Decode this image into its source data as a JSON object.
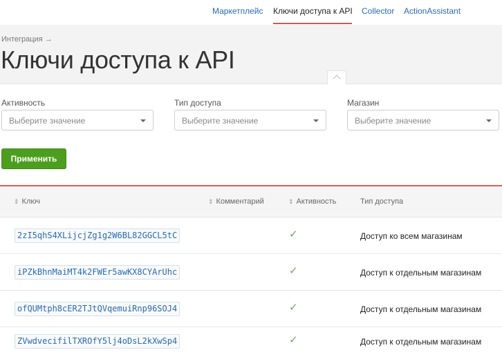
{
  "nav": {
    "tabs": [
      {
        "label": "Маркетплейс"
      },
      {
        "label": "Ключи доступа к API"
      },
      {
        "label": "Collector"
      },
      {
        "label": "ActionAssistant"
      }
    ]
  },
  "header": {
    "breadcrumb": "Интеграция →",
    "title": "Ключи доступа к API"
  },
  "filters": {
    "activity": {
      "label": "Активность",
      "placeholder": "Выберите значение"
    },
    "access_type": {
      "label": "Тип доступа",
      "placeholder": "Выберите значение"
    },
    "shop": {
      "label": "Магазин",
      "placeholder": "Выберите значение"
    },
    "apply_label": "Применить"
  },
  "table": {
    "headers": {
      "sort_glyph": "⇕",
      "key": "Ключ",
      "comment": "Комментарий",
      "activity": "Активность",
      "access_type": "Тип доступа"
    },
    "rows": [
      {
        "key": "2zI5qhS4XLijcjZg1g2W6BL82GGCL5tC",
        "active": "✓",
        "access": "Доступ ко всем магазинам"
      },
      {
        "key": "iPZkBhnMaiMT4k2FWEr5awKX8CYArUhc",
        "active": "✓",
        "access": "Доступ к отдельным магазинам"
      },
      {
        "key": "ofQUMtph8cER2TJtQVqemuiRnp96SOJ4",
        "active": "✓",
        "access": "Доступ к отдельным магазинам"
      },
      {
        "key": "ZVwdvecifilTXROfY5lj4oDsL2kXwSp4",
        "active": "✓",
        "access": "Доступ к отдельным магазинам"
      }
    ]
  },
  "colors": {
    "accent_red": "#d9534f",
    "link_blue": "#2a6bb0",
    "button_green": "#4c9e1f",
    "check_green": "#6aa84f"
  }
}
